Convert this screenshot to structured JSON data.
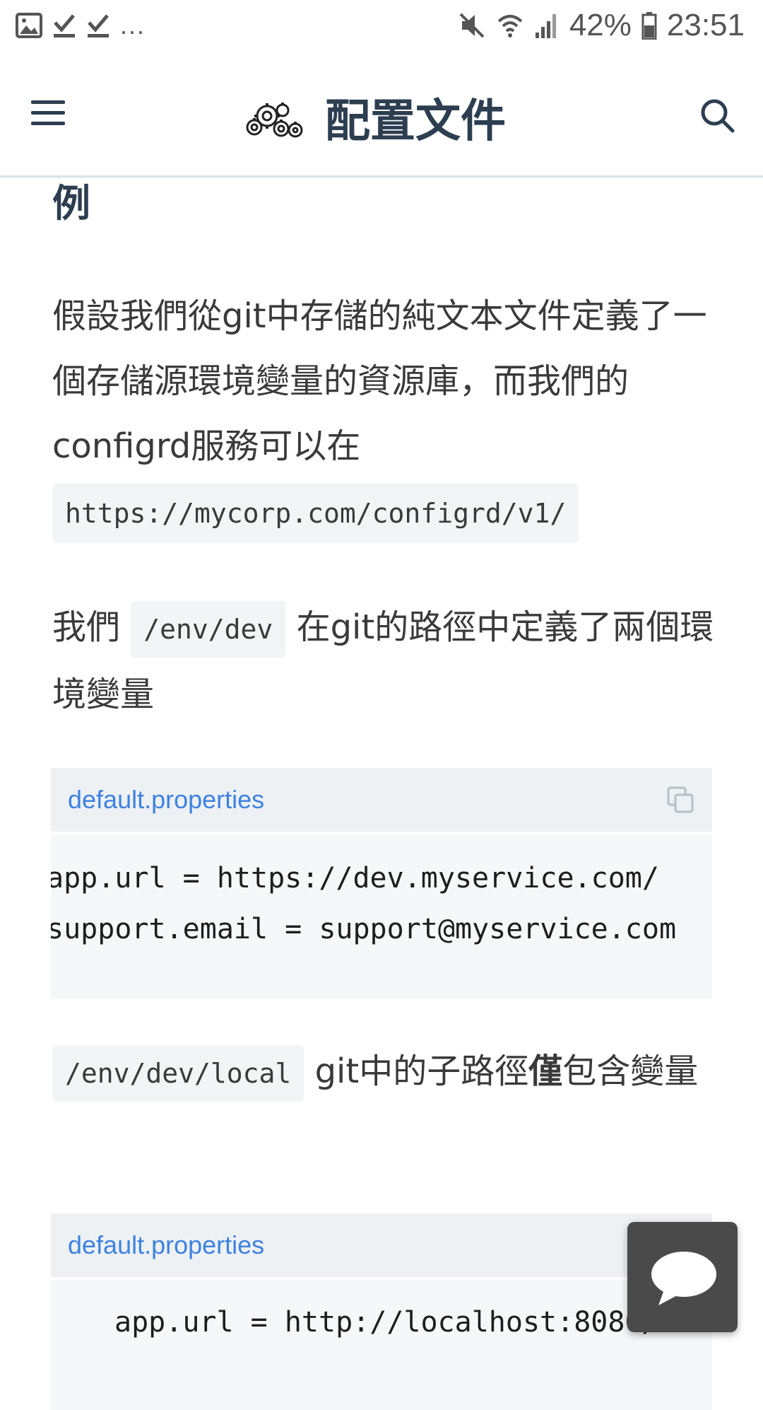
{
  "status_bar": {
    "dots": "...",
    "battery": "42%",
    "time": "23:51"
  },
  "header": {
    "title": "配置文件"
  },
  "content": {
    "fragment_heading": "例",
    "para1_text": "假設我們從git中存儲的純文本文件定義了一個存儲源環境變量的資源庫，而我們的configrd服務可以在",
    "para1_code": "https://mycorp.com/configrd/v1/",
    "para2_before": "我們",
    "para2_code": "/env/dev",
    "para2_after": "在git的路徑中定義了兩個環境變量",
    "code1": {
      "filename": "default.properties",
      "line1": "app.url = https://dev.myservice.com/",
      "line2": "support.email = support@myservice.com"
    },
    "para3_code": "/env/dev/local",
    "para3_text1": "git中的子路徑",
    "para3_bold": "僅",
    "para3_text2": "包含變量",
    "code2": {
      "filename": "default.properties",
      "line1": "app.url = http://localhost:8080/"
    }
  },
  "colors": {
    "accent": "#3e82e0",
    "text": "#2c3e50",
    "code_bg": "#f3f4f5",
    "chat_button": "#4a4a4a"
  },
  "icons": [
    "gallery-icon",
    "download-done-icon",
    "mute-icon",
    "wifi-icon",
    "signal-icon",
    "battery-icon",
    "menu-icon",
    "gears-logo-icon",
    "search-icon",
    "copy-icon",
    "chat-icon"
  ]
}
